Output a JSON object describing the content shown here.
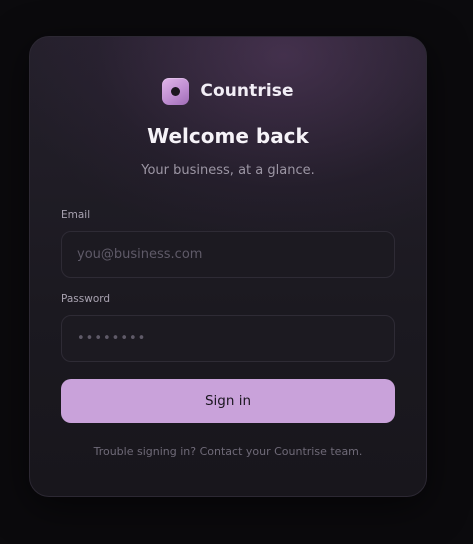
{
  "brand": {
    "name": "Countrise",
    "logo_icon": "circle-dot-icon",
    "accent_color": "#c9a2da"
  },
  "title": "Welcome back",
  "subtitle": "Your business, at a glance.",
  "form": {
    "email_label": "Email",
    "email_placeholder": "you@business.com",
    "password_label": "Password",
    "password_placeholder": "••••••••",
    "submit_label": "Sign in"
  },
  "help_text": "Trouble signing in? Contact your Countrise team."
}
